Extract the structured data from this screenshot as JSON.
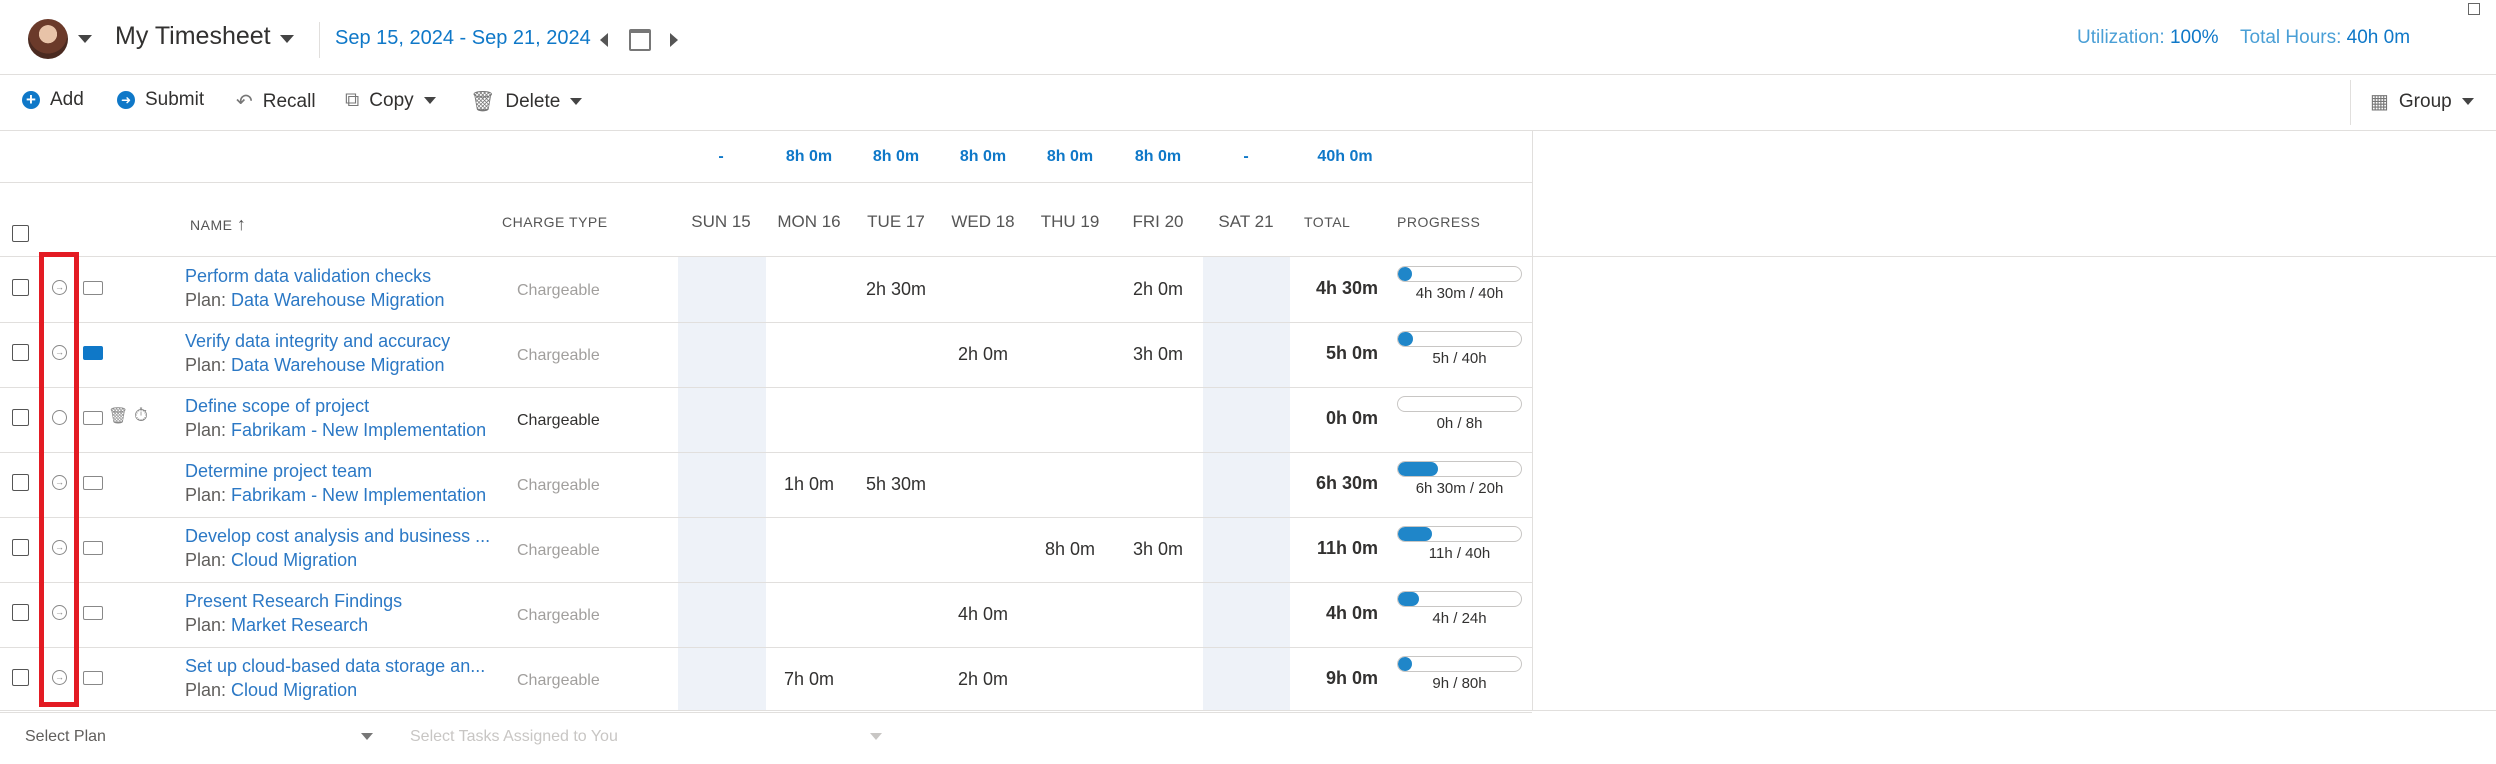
{
  "header": {
    "title": "My Timesheet",
    "date_range": "Sep 15, 2024 - Sep 21, 2024",
    "utilization_label": "Utilization:",
    "utilization_value": "100%",
    "total_hours_label": "Total Hours:",
    "total_hours_value": "40h 0m"
  },
  "toolbar": {
    "add": "Add",
    "submit": "Submit",
    "recall": "Recall",
    "copy": "Copy",
    "delete": "Delete",
    "group": "Group"
  },
  "day_totals": [
    "-",
    "8h 0m",
    "8h 0m",
    "8h 0m",
    "8h 0m",
    "8h 0m",
    "-",
    "40h 0m"
  ],
  "columns": {
    "name": "NAME",
    "charge_type": "CHARGE TYPE",
    "days": [
      "SUN 15",
      "MON 16",
      "TUE 17",
      "WED 18",
      "THU 19",
      "FRI 20",
      "SAT 21"
    ],
    "total": "TOTAL",
    "progress": "PROGRESS"
  },
  "rows": [
    {
      "name": "Perform data validation checks",
      "plan_prefix": "Plan:",
      "plan": "Data Warehouse Migration",
      "charge": "Chargeable",
      "days": [
        "",
        "",
        "2h 30m",
        "",
        "",
        "2h 0m",
        ""
      ],
      "total": "4h 30m",
      "progress_text": "4h 30m / 40h",
      "progress": 0.11
    },
    {
      "name": "Verify data integrity and accuracy",
      "plan_prefix": "Plan:",
      "plan": "Data Warehouse Migration",
      "charge": "Chargeable",
      "days": [
        "",
        "",
        "",
        "2h 0m",
        "",
        "3h 0m",
        ""
      ],
      "total": "5h 0m",
      "progress_text": "5h / 40h",
      "progress": 0.125
    },
    {
      "name": "Define scope of project",
      "plan_prefix": "Plan:",
      "plan": "Fabrikam - New Implementation",
      "charge": "Chargeable",
      "days": [
        "",
        "",
        "",
        "",
        "",
        "",
        ""
      ],
      "total": "0h 0m",
      "progress_text": "0h / 8h",
      "progress": 0
    },
    {
      "name": "Determine project team",
      "plan_prefix": "Plan:",
      "plan": "Fabrikam - New Implementation",
      "charge": "Chargeable",
      "days": [
        "",
        "1h 0m",
        "5h 30m",
        "",
        "",
        "",
        ""
      ],
      "total": "6h 30m",
      "progress_text": "6h 30m / 20h",
      "progress": 0.325
    },
    {
      "name": "Develop cost analysis and business ...",
      "plan_prefix": "Plan:",
      "plan": "Cloud Migration",
      "charge": "Chargeable",
      "days": [
        "",
        "",
        "",
        "",
        "8h 0m",
        "3h 0m",
        ""
      ],
      "total": "11h 0m",
      "progress_text": "11h / 40h",
      "progress": 0.275
    },
    {
      "name": "Present Research Findings",
      "plan_prefix": "Plan:",
      "plan": "Market Research",
      "charge": "Chargeable",
      "days": [
        "",
        "",
        "",
        "4h 0m",
        "",
        "",
        ""
      ],
      "total": "4h 0m",
      "progress_text": "4h / 24h",
      "progress": 0.167
    },
    {
      "name": "Set up cloud-based data storage an...",
      "plan_prefix": "Plan:",
      "plan": "Cloud Migration",
      "charge": "Chargeable",
      "days": [
        "",
        "7h 0m",
        "",
        "2h 0m",
        "",
        "",
        ""
      ],
      "total": "9h 0m",
      "progress_text": "9h / 80h",
      "progress": 0.1125
    }
  ],
  "footer": {
    "select_plan": "Select Plan",
    "select_tasks": "Select Tasks Assigned to You"
  }
}
